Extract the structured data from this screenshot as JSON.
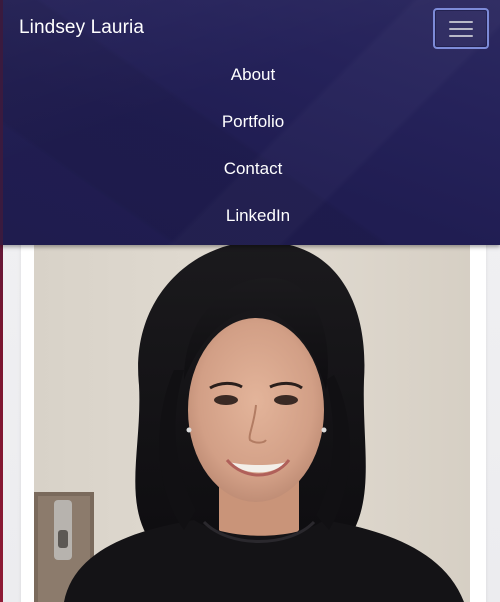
{
  "navbar": {
    "brand": "Lindsey Lauria",
    "toggler_icon": "hamburger-menu-icon",
    "links": [
      {
        "label": "About"
      },
      {
        "label": "Portfolio"
      },
      {
        "label": "Contact"
      },
      {
        "label": "LinkedIn"
      }
    ],
    "colors": {
      "background": "#24215a",
      "text": "#ffffff",
      "toggler_border": "#7d8bd8"
    }
  },
  "profile_photo": {
    "subject_icon": "portrait-photo"
  },
  "page": {
    "background": "#efeff1",
    "accent_edge": "#8f1a35"
  }
}
